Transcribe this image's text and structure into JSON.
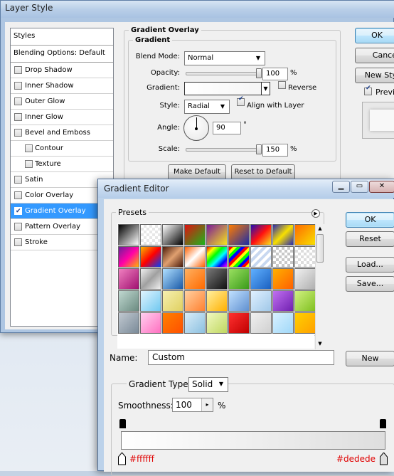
{
  "layer_style": {
    "title": "Layer Style",
    "styles_header": "Styles",
    "blending_header": "Blending Options: Default",
    "effects": [
      {
        "label": "Drop Shadow",
        "checked": false,
        "indent": false,
        "selected": false
      },
      {
        "label": "Inner Shadow",
        "checked": false,
        "indent": false,
        "selected": false
      },
      {
        "label": "Outer Glow",
        "checked": false,
        "indent": false,
        "selected": false
      },
      {
        "label": "Inner Glow",
        "checked": false,
        "indent": false,
        "selected": false
      },
      {
        "label": "Bevel and Emboss",
        "checked": false,
        "indent": false,
        "selected": false
      },
      {
        "label": "Contour",
        "checked": false,
        "indent": true,
        "selected": false
      },
      {
        "label": "Texture",
        "checked": false,
        "indent": true,
        "selected": false
      },
      {
        "label": "Satin",
        "checked": false,
        "indent": false,
        "selected": false
      },
      {
        "label": "Color Overlay",
        "checked": false,
        "indent": false,
        "selected": false
      },
      {
        "label": "Gradient Overlay",
        "checked": true,
        "indent": false,
        "selected": true
      },
      {
        "label": "Pattern Overlay",
        "checked": false,
        "indent": false,
        "selected": false
      },
      {
        "label": "Stroke",
        "checked": false,
        "indent": false,
        "selected": false
      }
    ],
    "section_title": "Gradient Overlay",
    "group_title": "Gradient",
    "blend_mode_label": "Blend Mode:",
    "blend_mode_value": "Normal",
    "opacity_label": "Opacity:",
    "opacity_value": "100",
    "opacity_level": 1.0,
    "percent": "%",
    "gradient_label": "Gradient:",
    "reverse_label": "Reverse",
    "reverse_checked": false,
    "style_label": "Style:",
    "style_value": "Radial",
    "align_label": "Align with Layer",
    "align_checked": true,
    "angle_label": "Angle:",
    "angle_value": "90",
    "degree": "°",
    "scale_label": "Scale:",
    "scale_value": "150",
    "scale_level": 1.0,
    "make_default": "Make Default",
    "reset_default": "Reset to Default",
    "ok": "OK",
    "cancel": "Cance",
    "new_style": "New Sty",
    "preview": "Previ",
    "preview_checked": true
  },
  "gradient_editor": {
    "title": "Gradient Editor",
    "presets_label": "Presets",
    "ok": "OK",
    "reset": "Reset",
    "load": "Load...",
    "save": "Save...",
    "name_label": "Name:",
    "name_value": "Custom",
    "new_button": "New",
    "gradient_type_label": "Gradient Type:",
    "gradient_type_value": "Solid",
    "smoothness_label": "Smoothness:",
    "smoothness_value": "100",
    "smoothness_unit": "%",
    "start_color": "#ffffff",
    "end_color": "#dedede",
    "swatches": [
      "linear-gradient(135deg,#000,#fff)",
      "repeating-conic-gradient(#e7e7e7 0 25%,#fff 0 50%) 0 0/8px 8px",
      "linear-gradient(135deg,#fff,#000)",
      "linear-gradient(135deg,#e01010,#1ab61a)",
      "linear-gradient(135deg,#7a1a9a,#f7e51b)",
      "linear-gradient(135deg,#ff7b00,#1a2ca8)",
      "linear-gradient(135deg,#1f0fb6,#ff1010,#f7e51b)",
      "linear-gradient(135deg,#2a2ab0,#f8e000,#2a2ab0)",
      "linear-gradient(135deg,#ff6a00,#f8e000)",
      "linear-gradient(135deg,#6b1f9a,#ff00a8,#ffb300)",
      "linear-gradient(135deg,#f7b500,#ff0000,#0040ff)",
      "linear-gradient(135deg,#4a1a0a,#e0a070,#4a1a0a)",
      "linear-gradient(135deg,#ff6000,#fff,#ff6000)",
      "linear-gradient(135deg,#e00,#ff0,#0f0,#0ff,#00f,#f0f)",
      "repeating-linear-gradient(135deg,#f00 0 4px,#ff0 4px 8px,#0f0 8px 12px,#00f 12px 16px)",
      "repeating-linear-gradient(135deg,#fff 0 4px,#c8d8f0 4px 8px)",
      "repeating-conic-gradient(#c8c8c8 0 25%,#fff 0 50%) 0 0/8px 8px",
      "repeating-conic-gradient(#ddd 0 25%,#fff 0 50%) 0 0/8px 8px",
      "linear-gradient(135deg,#f080c0,#a01070)",
      "linear-gradient(135deg,#f0f0f0,#a0a0a0,#f0f0f0)",
      "linear-gradient(135deg,#b0e0ff,#1a5aa8)",
      "linear-gradient(135deg,#ffb060,#ff6a00)",
      "linear-gradient(135deg,#777,#111)",
      "linear-gradient(135deg,#9ae060,#3a9a1a)",
      "linear-gradient(135deg,#60b0ff,#1a60c0)",
      "linear-gradient(135deg,#ffb000,#ff6000)",
      "linear-gradient(135deg,#f0f0f0,#b0b0b0)",
      "linear-gradient(135deg,#c0d8d0,#6a8a80)",
      "linear-gradient(135deg,#e0f4ff,#70c8f0)",
      "linear-gradient(135deg,#f6f0b0,#e0d060)",
      "linear-gradient(135deg,#ffd0a0,#ff8030)",
      "linear-gradient(135deg,#fff0a0,#ffb000)",
      "linear-gradient(135deg,#c0e0ff,#6090d0)",
      "linear-gradient(135deg,#e0f0ff,#a0c8e8)",
      "linear-gradient(135deg,#c070f0,#7020b0)",
      "linear-gradient(135deg,#d0f080,#80c020)",
      "linear-gradient(135deg,#c0c8d0,#7a8a98)",
      "linear-gradient(135deg,#ffd0f0,#ff70c0)",
      "linear-gradient(135deg,#ff8000,#ff5000)",
      "linear-gradient(135deg,#d8ecf8,#8cc0e0)",
      "linear-gradient(135deg,#f0f8c0,#c0d860)",
      "linear-gradient(135deg,#ff3030,#c00000)",
      "linear-gradient(135deg,#f0f0f0,#d0d0d0)",
      "linear-gradient(135deg,#d8f0ff,#a0d8f8)",
      "linear-gradient(135deg,#ffd000,#ffa000)"
    ]
  }
}
